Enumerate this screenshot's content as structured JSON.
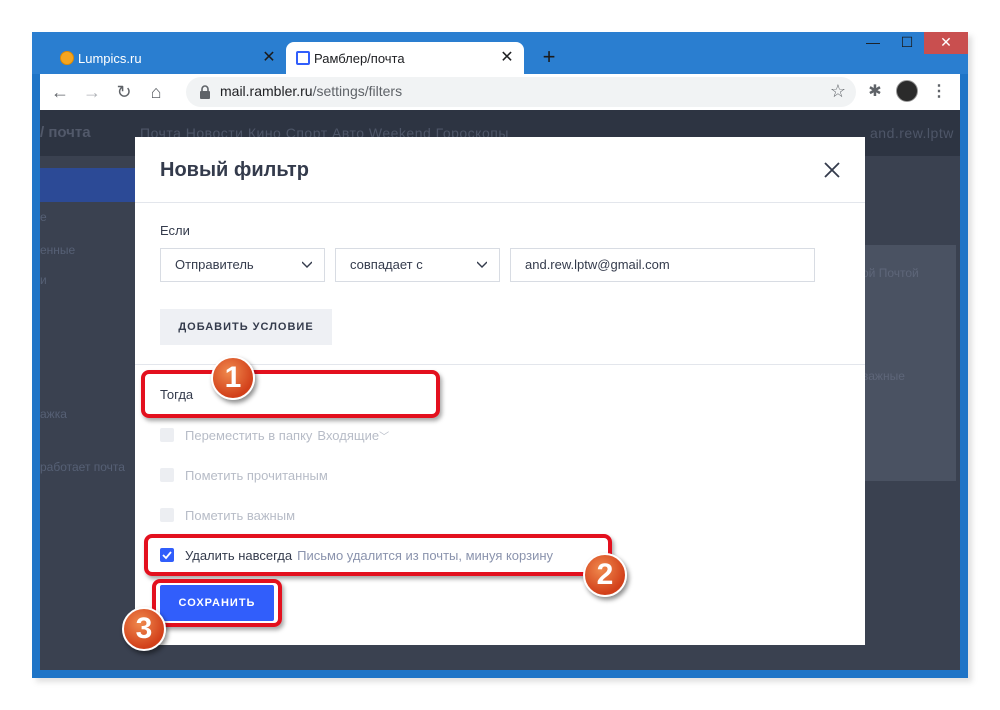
{
  "browser": {
    "tabs": [
      {
        "title": "Lumpics.ru",
        "active": false
      },
      {
        "title": "Рамблер/почта",
        "active": true
      }
    ],
    "new_tab": "+",
    "url_host": "mail.rambler.ru",
    "url_path": "/settings/filters"
  },
  "background": {
    "logo": "/ почта",
    "topnav": "Почта   Новости   Кино   Спорт   Авто   Weekend   Гороскопы",
    "user": "and.rew.lptw",
    "side_items": [
      "е",
      "енные",
      "и",
      "ажка",
      "работает почта"
    ],
    "card_texts": [
      "ой Почтой",
      "важные"
    ]
  },
  "modal": {
    "title": "Новый фильтр",
    "if_label": "Если",
    "field_select": "Отправитель",
    "operator_select": "совпадает с",
    "value_input": "and.rew.lptw@gmail.com",
    "add_condition": "ДОБАВИТЬ УСЛОВИЕ",
    "then_label": "Тогда",
    "actions": [
      {
        "label": "Переместить в папку",
        "extra": "Входящие",
        "checked": false
      },
      {
        "label": "Пометить прочитанным",
        "checked": false
      },
      {
        "label": "Пометить важным",
        "checked": false
      },
      {
        "label": "Удалить навсегда",
        "hint": "Письмо удалится из почты, минуя корзину",
        "checked": true
      }
    ],
    "save": "СОХРАНИТЬ"
  },
  "annotations": {
    "badge_1": "1",
    "badge_2": "2",
    "badge_3": "3",
    "color": "#e3101e"
  }
}
